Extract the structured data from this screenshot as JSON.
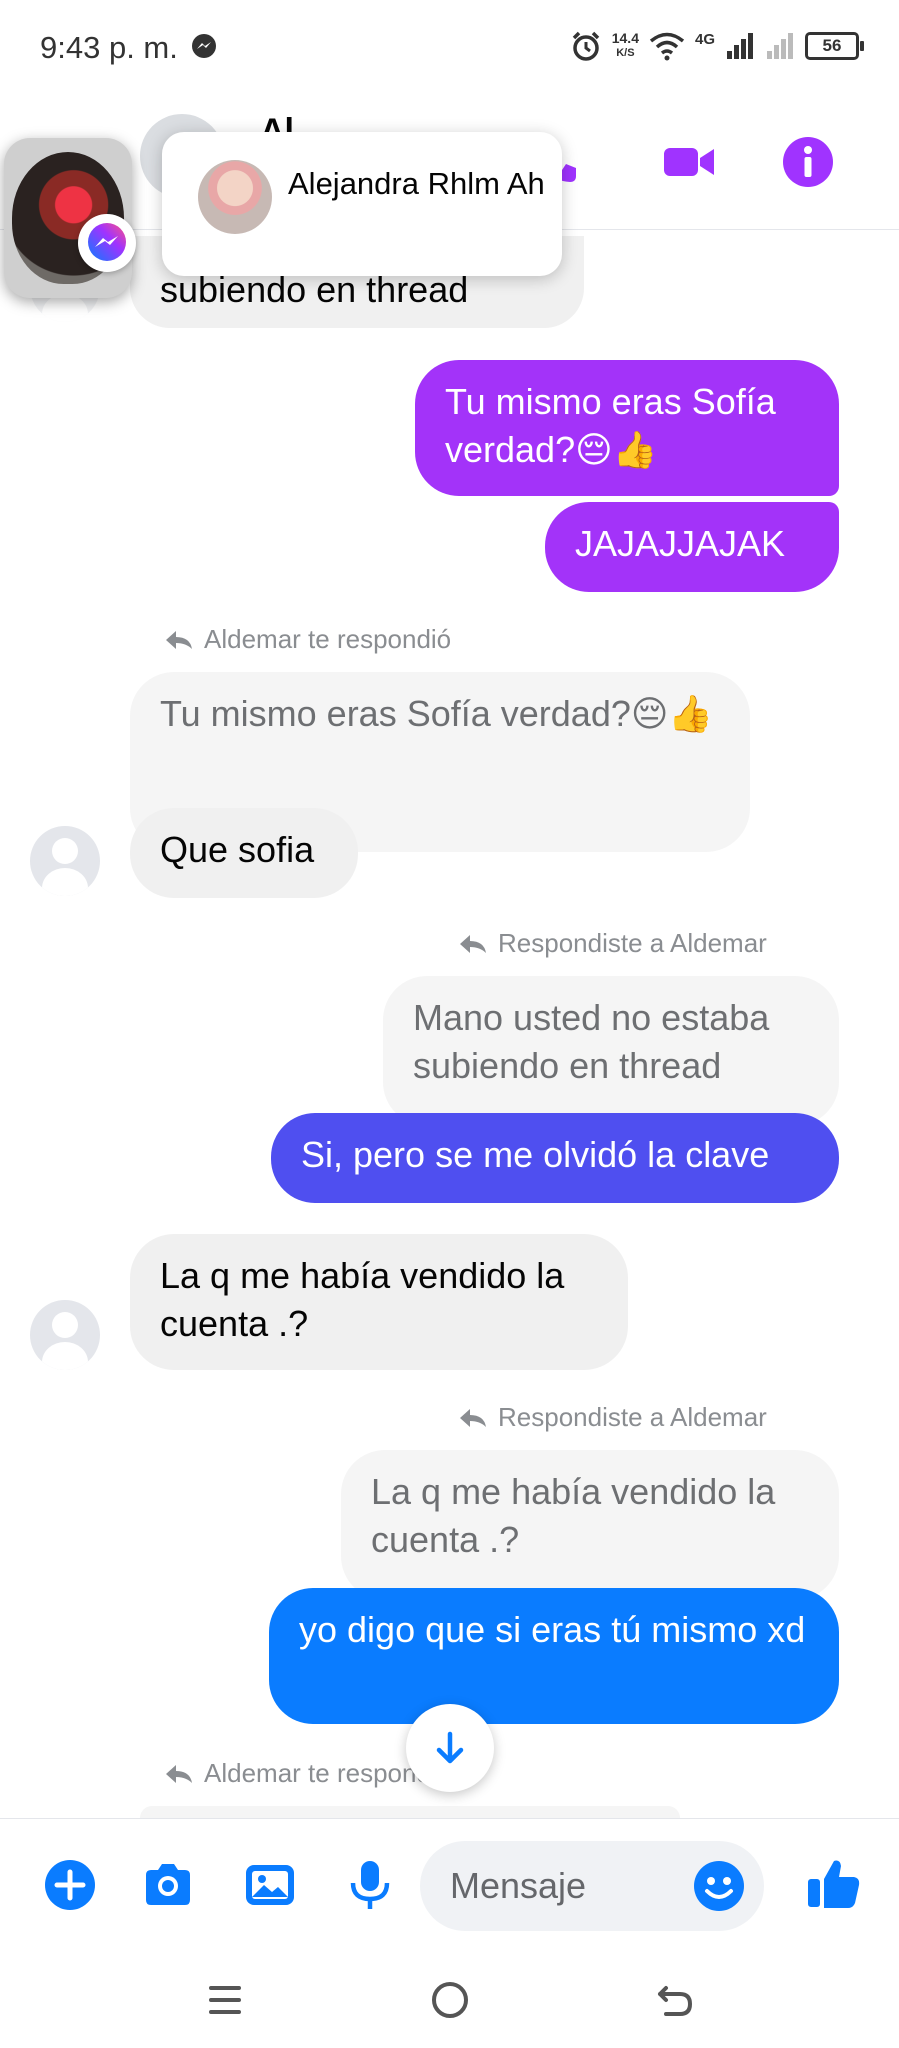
{
  "status": {
    "time": "9:43 p. m.",
    "net_speed_value": "14.4",
    "net_speed_unit": "K/S",
    "network_type": "4G",
    "battery": "56"
  },
  "header": {
    "contact_name": "Al..",
    "icons": [
      "phone-icon",
      "video-call-icon",
      "info-icon"
    ],
    "accent_color": "#a033ff"
  },
  "chat_head": {
    "tooltip_name": "Alejandra Rhlm Ah"
  },
  "messages": {
    "m0_partial": "subiendo en thread",
    "m1": "Tu mismo eras Sofía verdad?😔👍",
    "m2": "JAJAJJAJAK",
    "reply1_label": "Aldemar te respondió",
    "reply1_quote": "Tu mismo eras Sofía verdad?😔👍",
    "m3": "Que sofia",
    "reply2_label": "Respondiste a Aldemar",
    "reply2_quote": "Mano usted no estaba subiendo en thread",
    "m4": "Si, pero se me olvidó la clave",
    "m5": "La q me había vendido la cuenta .?",
    "reply3_label": "Respondiste a Aldemar",
    "reply3_quote": "La q me había vendido la cuenta .?",
    "m6": "yo digo que si eras tú mismo xd",
    "reply4_label": "Aldemar te respondió"
  },
  "composer": {
    "placeholder": "Mensaje",
    "icons": [
      "add-icon",
      "camera-icon",
      "gallery-icon",
      "microphone-icon",
      "emoji-icon",
      "like-icon"
    ]
  },
  "colors": {
    "purple": "#a333f9",
    "indigo": "#4f4ff0",
    "blue": "#0a7cff",
    "incoming": "#f0f0f0"
  }
}
